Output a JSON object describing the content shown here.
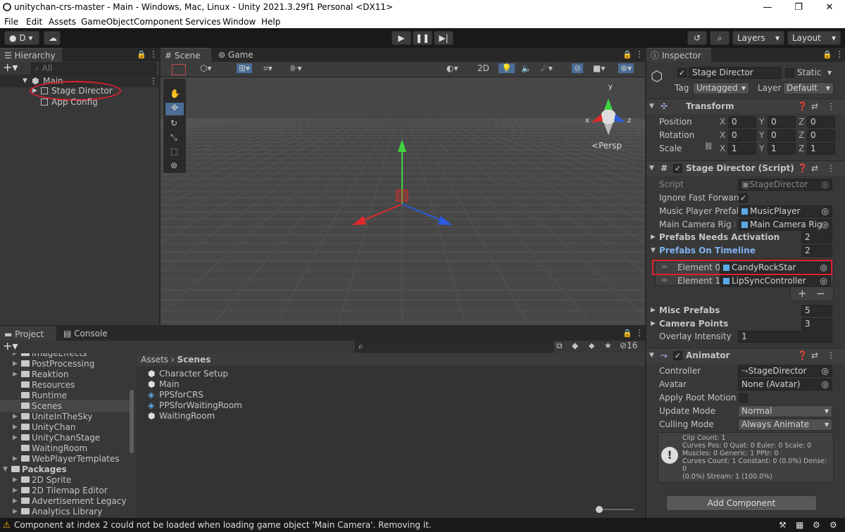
{
  "window": {
    "title": "unitychan-crs-master - Main - Windows, Mac, Linux - Unity 2021.3.29f1 Personal <DX11>",
    "minimize": "—",
    "maximize": "❐",
    "close": "✕"
  },
  "menu": [
    "File",
    "Edit",
    "Assets",
    "GameObject",
    "Component",
    "Services",
    "Window",
    "Help"
  ],
  "toolbar": {
    "account": "D",
    "layers": "Layers",
    "layout": "Layout"
  },
  "hierarchy": {
    "tab": "Hierarchy",
    "search_placeholder": "All",
    "items": [
      {
        "label": "Main",
        "depth": 0
      },
      {
        "label": "Stage Director",
        "depth": 1
      },
      {
        "label": "App Config",
        "depth": 1
      }
    ]
  },
  "scene": {
    "tabs": [
      "Scene",
      "Game"
    ],
    "toggle_2d": "2D",
    "persp": "Persp",
    "axis": {
      "x": "x",
      "y": "y",
      "z": "z"
    }
  },
  "inspector": {
    "tab": "Inspector",
    "object_name": "Stage Director",
    "static_label": "Static",
    "tag_label": "Tag",
    "tag_value": "Untagged",
    "layer_label": "Layer",
    "layer_value": "Default",
    "transform": {
      "title": "Transform",
      "rows": [
        {
          "label": "Position",
          "x": "0",
          "y": "0",
          "z": "0"
        },
        {
          "label": "Rotation",
          "x": "0",
          "y": "0",
          "z": "0"
        },
        {
          "label": "Scale",
          "x": "1",
          "y": "1",
          "z": "1"
        }
      ]
    },
    "script_comp": {
      "title": "Stage Director (Script)",
      "script_label": "Script",
      "script_value": "StageDirector",
      "ignore_ff": "Ignore Fast Forward",
      "music_label": "Music Player Prefab",
      "music_value": "MusicPlayer",
      "camrig_label": "Main Camera Rig Pre",
      "camrig_value": "Main Camera Rig",
      "pna_label": "Prefabs Needs Activation",
      "pna_value": "2",
      "pot_label": "Prefabs On Timeline",
      "pot_value": "2",
      "elements": [
        {
          "label": "Element 0",
          "value": "CandyRockStar"
        },
        {
          "label": "Element 1",
          "value": "LipSyncController"
        }
      ],
      "plus": "+",
      "minus": "−",
      "misc_label": "Misc Prefabs",
      "misc_value": "5",
      "cam_label": "Camera Points",
      "cam_value": "3",
      "overlay_label": "Overlay Intensity",
      "overlay_value": "1"
    },
    "animator": {
      "title": "Animator",
      "controller_label": "Controller",
      "controller_value": "StageDirector",
      "avatar_label": "Avatar",
      "avatar_value": "None (Avatar)",
      "root_label": "Apply Root Motion",
      "update_label": "Update Mode",
      "update_value": "Normal",
      "culling_label": "Culling Mode",
      "culling_value": "Always Animate",
      "info": [
        "Clip Count: 1",
        "Curves Pos: 0 Quat: 0 Euler: 0 Scale: 0",
        "Muscles: 0 Generic: 1 PPtr: 0",
        "Curves Count: 1 Constant: 0 (0.0%) Dense: 0",
        "(0.0%) Stream: 1 (100.0%)"
      ]
    },
    "add_component": "Add Component"
  },
  "project": {
    "tabs": [
      "Project",
      "Console"
    ],
    "hidden_count": "16",
    "tree": [
      {
        "label": "ImageEffects",
        "depth": 1
      },
      {
        "label": "PostProcessing",
        "depth": 1
      },
      {
        "label": "Reaktion",
        "depth": 1
      },
      {
        "label": "Resources",
        "depth": 1
      },
      {
        "label": "Runtime",
        "depth": 1
      },
      {
        "label": "Scenes",
        "depth": 1
      },
      {
        "label": "UniteInTheSky",
        "depth": 1
      },
      {
        "label": "UnityChan",
        "depth": 1
      },
      {
        "label": "UnityChanStage",
        "depth": 1
      },
      {
        "label": "WaitingRoom",
        "depth": 1
      },
      {
        "label": "WebPlayerTemplates",
        "depth": 1
      },
      {
        "label": "Packages",
        "depth": 0
      },
      {
        "label": "2D Sprite",
        "depth": 1
      },
      {
        "label": "2D Tilemap Editor",
        "depth": 1
      },
      {
        "label": "Advertisement Legacy",
        "depth": 1
      },
      {
        "label": "Analytics Library",
        "depth": 1
      }
    ],
    "breadcrumb": [
      "Assets",
      "Scenes"
    ],
    "assets": [
      "Character Setup",
      "Main",
      "PPSforCRS",
      "PPSforWaitingRoom",
      "WaitingRoom"
    ]
  },
  "status": {
    "message": "Component at index 2 could not be loaded when loading game object 'Main Camera'. Removing it."
  },
  "colors": {
    "accent": "#3a79bb",
    "highlight": "#e0202f",
    "warning": "#f4bc02",
    "bg": "#383838"
  }
}
